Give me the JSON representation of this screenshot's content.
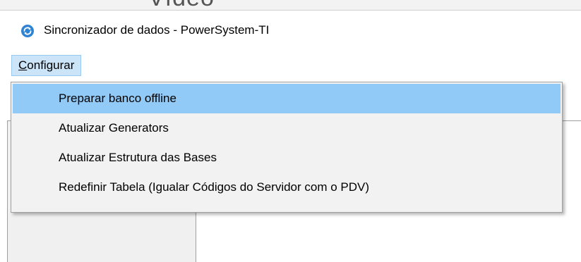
{
  "background": {
    "title_fragment": "Vídeo"
  },
  "window": {
    "title": "Sincronizador de dados - PowerSystem-TI",
    "icon": "sync-icon"
  },
  "menu_bar": {
    "configurar": {
      "mnemonic": "C",
      "rest": "onfigurar"
    }
  },
  "dropdown": {
    "items": [
      {
        "label": "Preparar banco offline",
        "highlighted": true
      },
      {
        "label": "Atualizar Generators",
        "highlighted": false
      },
      {
        "label": "Atualizar Estrutura das Bases",
        "highlighted": false
      },
      {
        "label": "Redefinir Tabela (Igualar Códigos do Servidor com o PDV)",
        "highlighted": false
      }
    ]
  },
  "colors": {
    "accent": "#2f83d3",
    "menu_selected_bg": "#cce4f7",
    "item_highlight_bg": "#91c9f7"
  }
}
